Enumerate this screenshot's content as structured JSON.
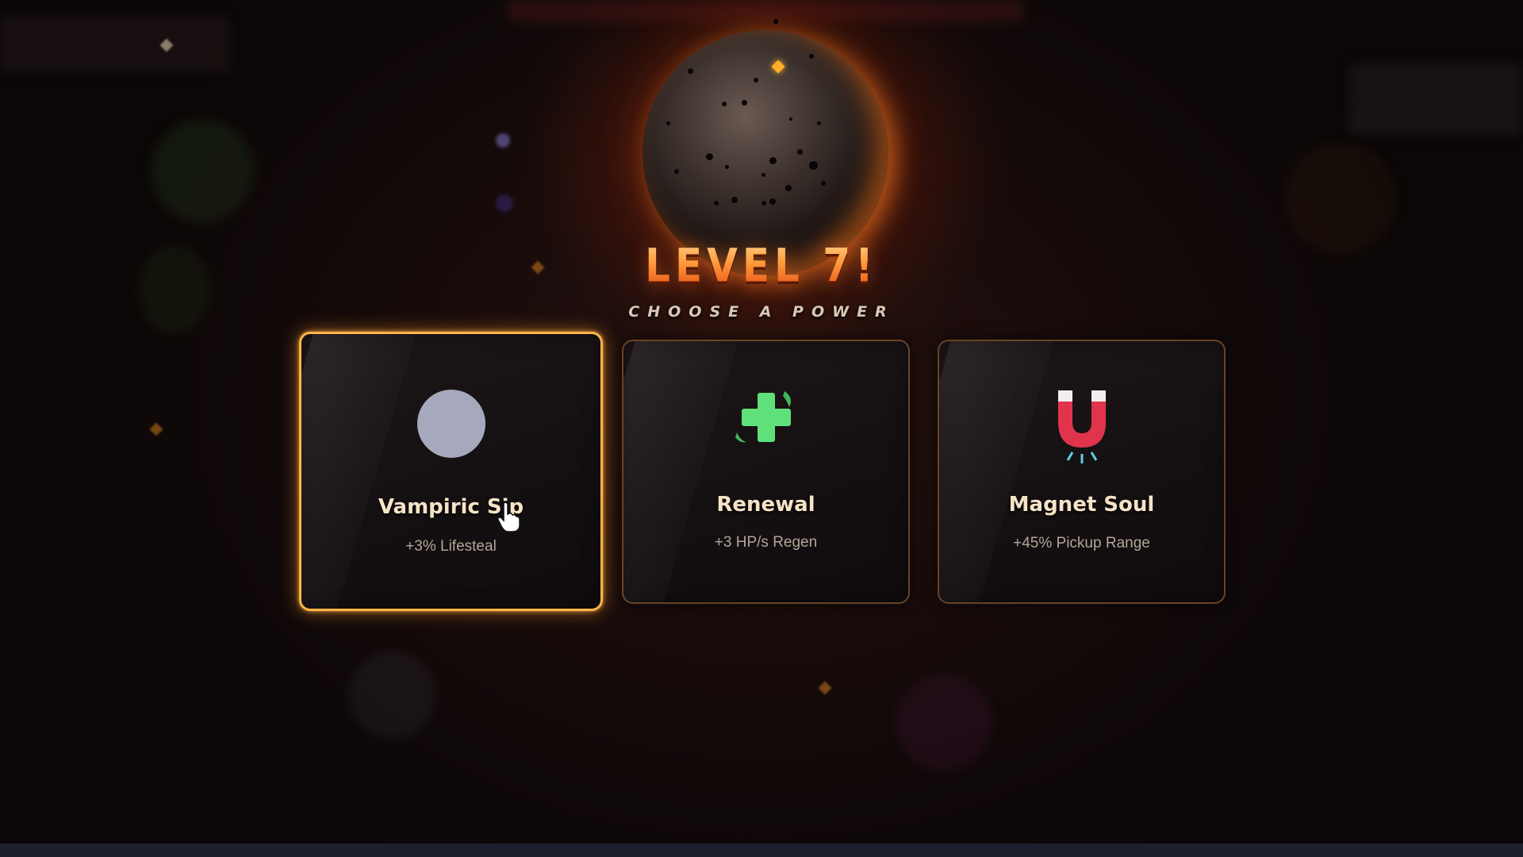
{
  "title": "LEVEL 7!",
  "subtitle": "CHOOSE A POWER",
  "cards": [
    {
      "name": "Vampiric Sip",
      "description": "+3% Lifesteal",
      "icon": "gray-circle-icon",
      "selected": true
    },
    {
      "name": "Renewal",
      "description": "+3 HP/s Regen",
      "icon": "green-cross-icon",
      "selected": false
    },
    {
      "name": "Magnet Soul",
      "description": "+45% Pickup Range",
      "icon": "magnet-icon",
      "selected": false
    }
  ],
  "colors": {
    "accent": "#ffb547",
    "title_gradient_top": "#ffd28a",
    "title_gradient_bottom": "#e24a14",
    "card_border": "#6a4324",
    "regen_green": "#5fe07a",
    "magnet_red": "#e0344c"
  }
}
